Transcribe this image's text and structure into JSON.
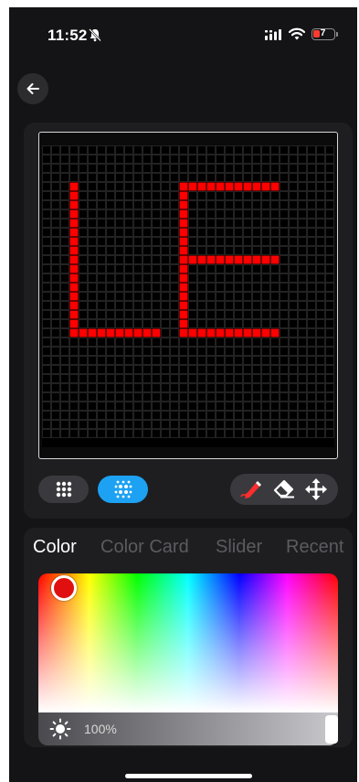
{
  "status_bar": {
    "time": "11:52",
    "battery_level": "7",
    "icons": [
      "bell-slash-icon",
      "signal-icon",
      "wifi-icon",
      "battery-icon"
    ]
  },
  "header": {
    "back_icon": "arrow-left-icon"
  },
  "pixel_canvas": {
    "background": "#000000",
    "pixel_color": "#ff0000",
    "grid_color": "#3a3a3a"
  },
  "mode_buttons": [
    {
      "name": "grid-dots-icon",
      "active": false
    },
    {
      "name": "grid-dots-active-icon",
      "active": true
    }
  ],
  "tools": [
    "pen-icon",
    "eraser-icon",
    "move-icon"
  ],
  "tabs": [
    "Color",
    "Color Card",
    "Slider",
    "Recent"
  ],
  "color_picker": {
    "selected_color": "#e01010"
  },
  "brightness": {
    "value": "100%",
    "icon": "sun-icon"
  },
  "colors": {
    "accent": "#1da1f2",
    "background": "#141416",
    "card": "#1e1e21"
  }
}
